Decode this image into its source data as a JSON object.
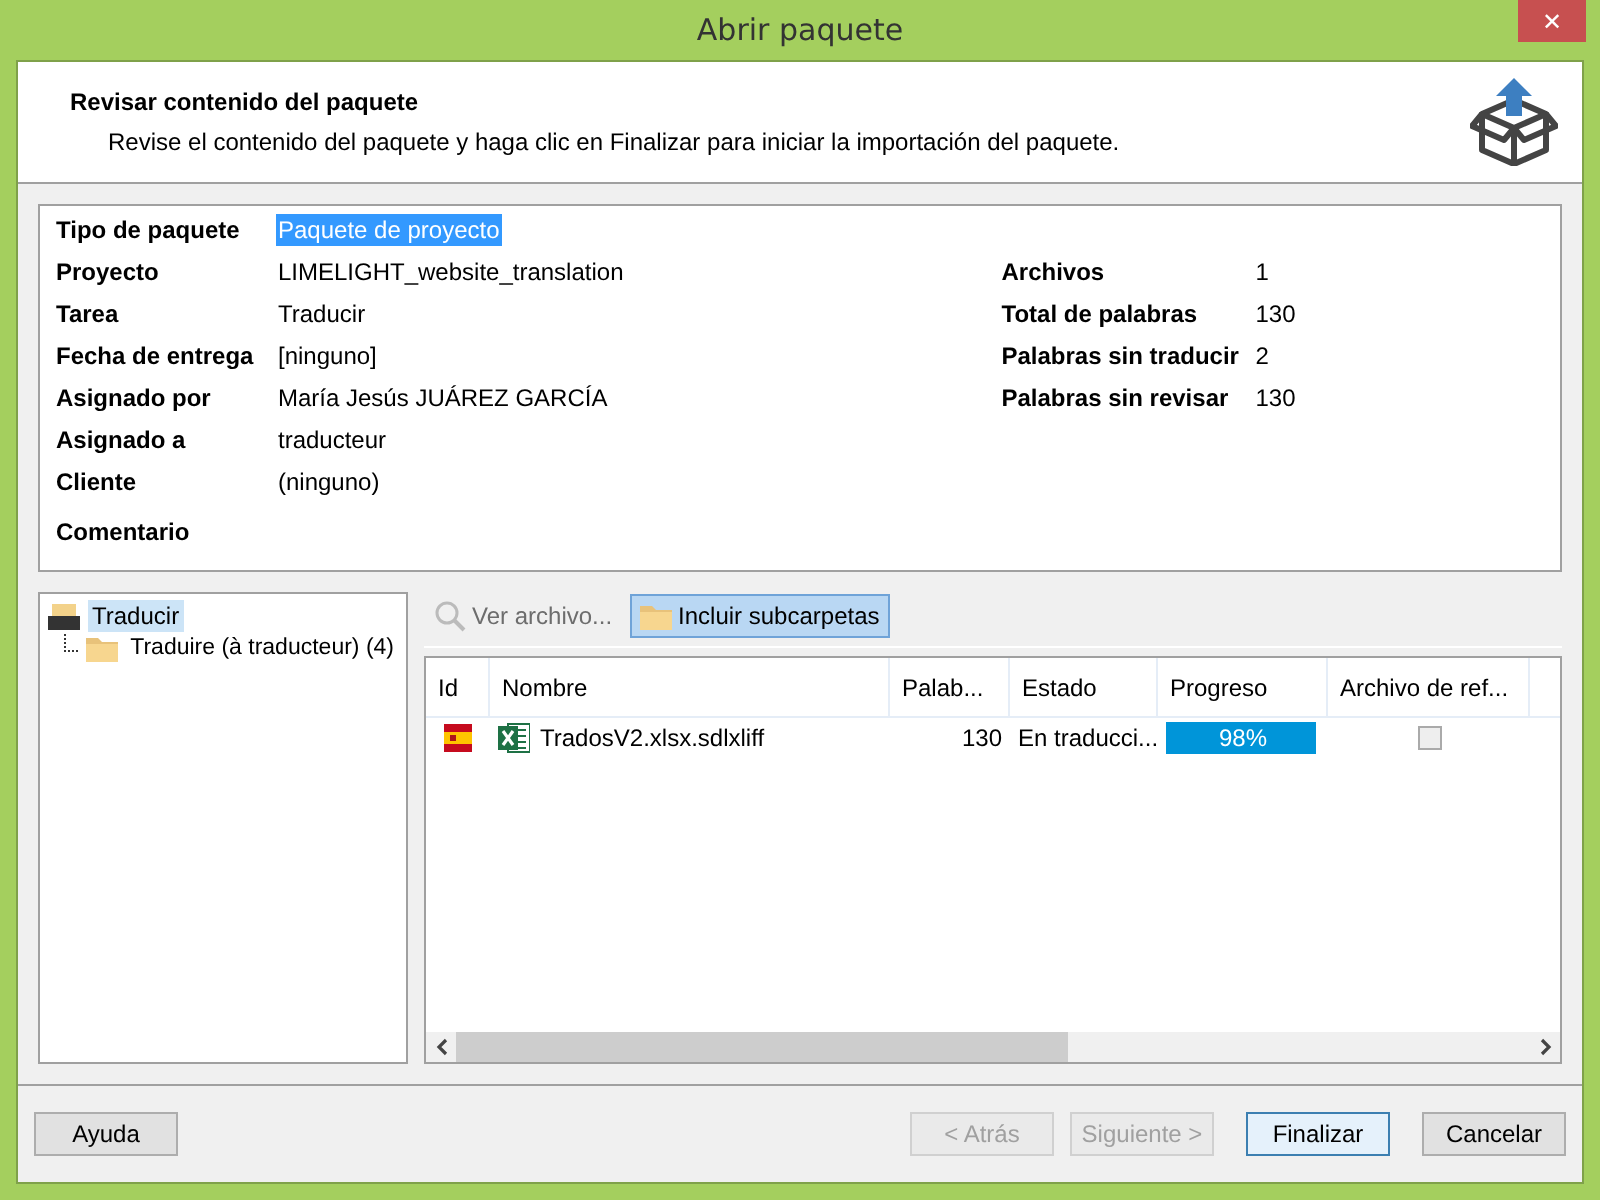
{
  "window": {
    "title": "Abrir paquete",
    "close": "✕"
  },
  "header": {
    "title": "Revisar contenido del paquete",
    "description": "Revise el contenido del paquete y haga clic en Finalizar para iniciar la importación del paquete."
  },
  "details": {
    "fields": [
      {
        "label": "Tipo de paquete",
        "value": "Paquete de proyecto",
        "selected": true
      },
      {
        "label": "Proyecto",
        "value": "LIMELIGHT_website_translation",
        "selected": false
      },
      {
        "label": "Tarea",
        "value": "Traducir",
        "selected": false
      },
      {
        "label": "Fecha de entrega",
        "value": "[ninguno]",
        "selected": false
      },
      {
        "label": "Asignado por",
        "value": "María Jesús JUÁREZ GARCÍA",
        "selected": false
      },
      {
        "label": "Asignado a",
        "value": "traducteur",
        "selected": false
      },
      {
        "label": "Cliente",
        "value": "(ninguno)",
        "selected": false
      },
      {
        "label": "Comentario"
      }
    ],
    "stats": [
      {
        "label": "Archivos",
        "value": "1"
      },
      {
        "label": "Total de palabras",
        "value": "130"
      },
      {
        "label": "Palabras sin traducir",
        "value": "2"
      },
      {
        "label": "Palabras sin revisar",
        "value": "130"
      }
    ]
  },
  "tree": [
    {
      "label": "Traducir",
      "kind": "package",
      "selected": true,
      "children": [
        {
          "label": "Traduire (à traducteur) (4)",
          "kind": "folder",
          "selected": false
        }
      ]
    }
  ],
  "toolbar": [
    {
      "label": "Ver archivo...",
      "kind": "search",
      "disabled": true,
      "on": false
    },
    {
      "label": "Incluir subcarpetas",
      "kind": "folder",
      "disabled": false,
      "on": true
    }
  ],
  "table": {
    "columns": [
      "Id",
      "Nombre",
      "Palab...",
      "Estado",
      "Progreso",
      "Archivo de ref..."
    ],
    "rows": [
      {
        "name": "TradosV2.xlsx.sdlxliff",
        "words": "130",
        "status": "En traducci...",
        "level": 0.98,
        "reading": "98%",
        "reference": false
      }
    ]
  },
  "buttons": [
    {
      "label": "Ayuda",
      "disabled": false,
      "default": false
    },
    {
      "label": "< Atrás",
      "disabled": true,
      "default": false
    },
    {
      "label": "Siguiente >",
      "disabled": true,
      "default": false
    },
    {
      "label": "Finalizar",
      "disabled": false,
      "default": true
    },
    {
      "label": "Cancelar",
      "disabled": false,
      "default": false
    }
  ]
}
